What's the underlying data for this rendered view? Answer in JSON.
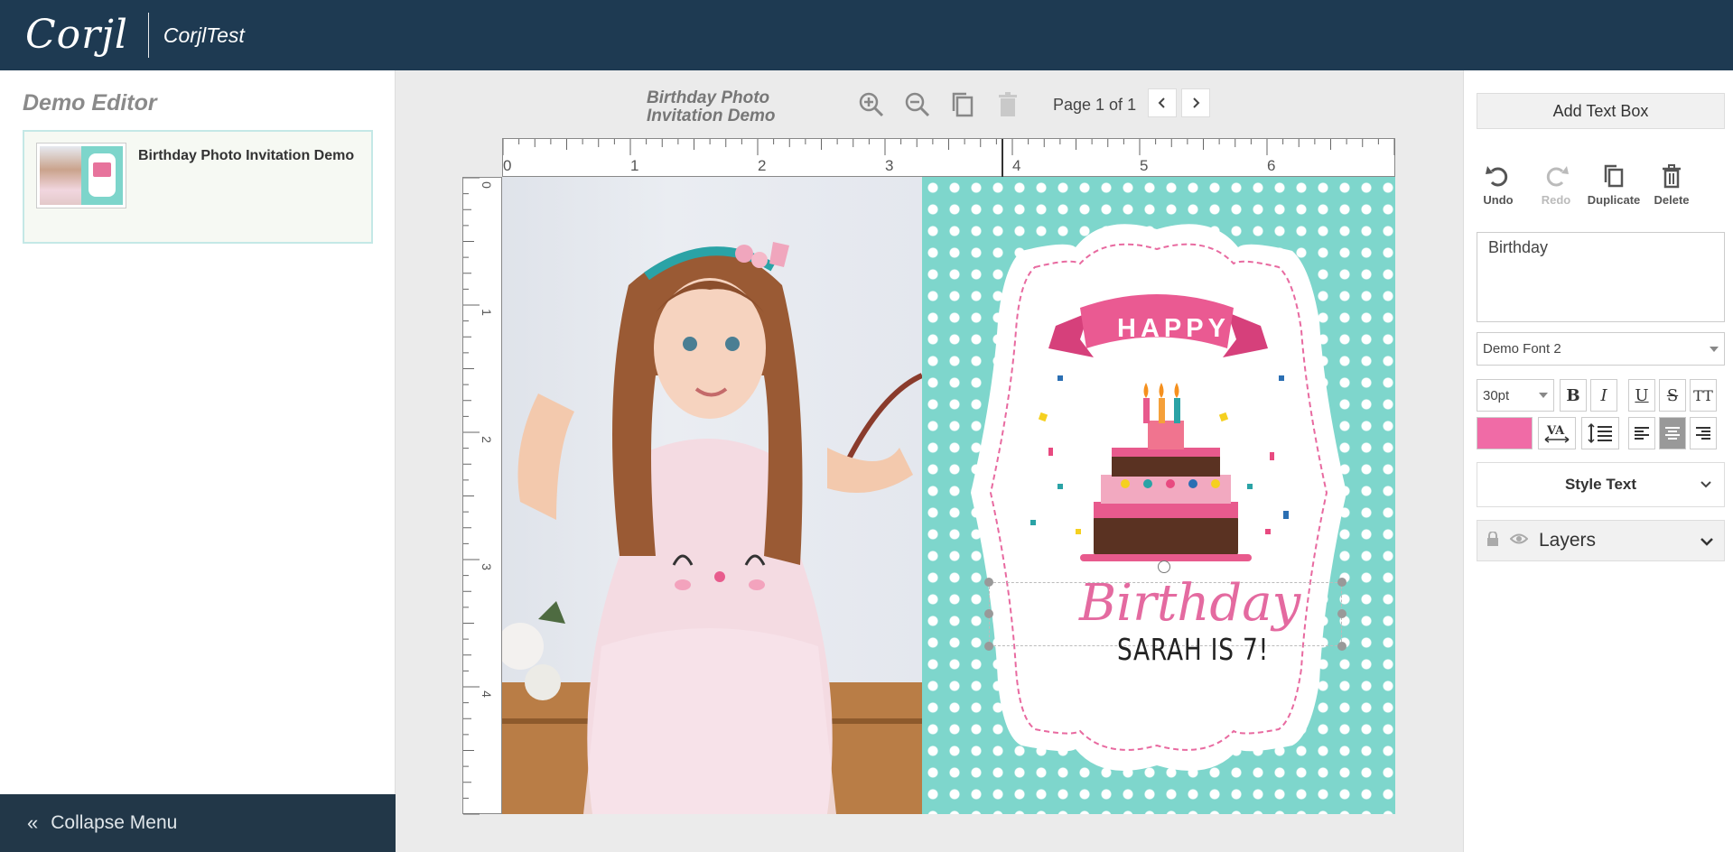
{
  "app": {
    "logo_text": "Corjl",
    "brand_name": "CorjlTest"
  },
  "sidebar": {
    "title": "Demo Editor",
    "project_name": "Birthday Photo Invitation Demo",
    "collapse_label": "Collapse Menu"
  },
  "toolbar": {
    "document_title": "Birthday Photo Invitation Demo",
    "page_label": "Page 1 of 1",
    "icons": [
      "zoom-in-icon",
      "zoom-out-icon",
      "copy-icon",
      "trash-icon"
    ]
  },
  "ruler": {
    "horizontal_labels": [
      "0",
      "1",
      "2",
      "3",
      "4",
      "5",
      "6"
    ],
    "vertical_labels": [
      "0",
      "1",
      "2",
      "3",
      "4"
    ]
  },
  "canvas": {
    "happy_text": "HAPPY",
    "birthday_text": "Birthday",
    "sub_text": "SARAH IS 7!",
    "card_color": "#7ed6cc",
    "accent_color": "#e46aa0"
  },
  "right_panel": {
    "add_text_label": "Add Text Box",
    "actions": {
      "undo": "Undo",
      "redo": "Redo",
      "duplicate": "Duplicate",
      "delete": "Delete"
    },
    "text_value": "Birthday",
    "font_name": "Demo Font 2",
    "font_size": "30pt",
    "text_color": "#f06ba6",
    "format_buttons": {
      "bold": "B",
      "italic": "I",
      "underline": "U",
      "strike": "S",
      "caps": "TT"
    },
    "style_text_label": "Style Text",
    "layers_label": "Layers"
  }
}
